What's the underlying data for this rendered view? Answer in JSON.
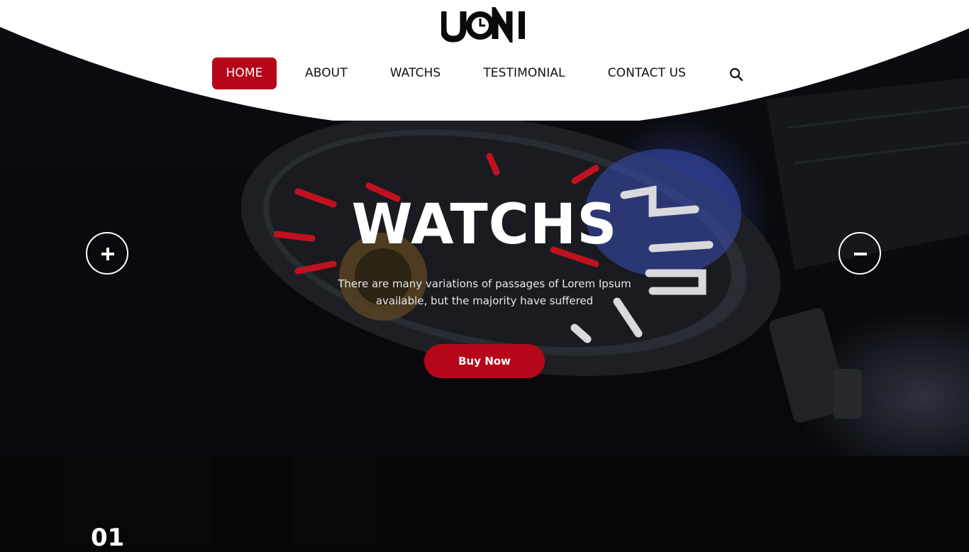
{
  "brand": {
    "logo_text": "UONI"
  },
  "nav": {
    "items": [
      {
        "label": "HOME",
        "active": true
      },
      {
        "label": "ABOUT"
      },
      {
        "label": "WATCHS"
      },
      {
        "label": "TESTIMONIAL"
      },
      {
        "label": "CONTACT US"
      }
    ],
    "search_icon": "search-icon"
  },
  "hero": {
    "title": "WATCHS",
    "description_line1": "There are many variations of passages of Lorem Ipsum",
    "description_line2": "available, but the majority have suffered",
    "cta_label": "Buy Now",
    "prev_icon": "plus-icon",
    "next_icon": "minus-icon"
  },
  "section": {
    "number": "01"
  },
  "colors": {
    "accent": "#b5061a",
    "background": "#050608",
    "header": "#ffffff",
    "text_dark": "#111111"
  }
}
